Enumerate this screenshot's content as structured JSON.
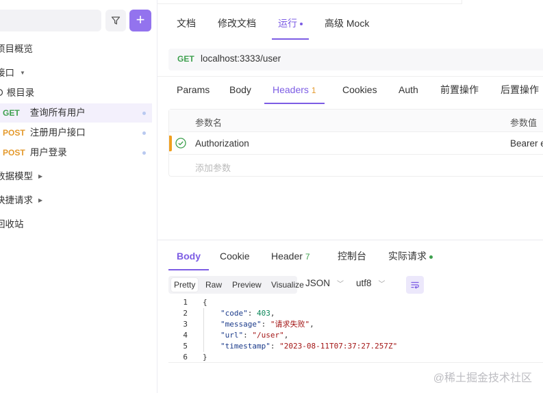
{
  "sidebar": {
    "nav": [
      {
        "label": "项目概览",
        "caret": ""
      },
      {
        "label": "接口",
        "caret": "▼"
      },
      {
        "label": "根目录",
        "caret": ""
      },
      {
        "label": "数据模型",
        "caret": "▶"
      },
      {
        "label": "快捷请求",
        "caret": "▶"
      },
      {
        "label": "回收站",
        "caret": ""
      }
    ],
    "apis": [
      {
        "method": "GET",
        "name": "查询所有用户"
      },
      {
        "method": "POST",
        "name": "注册用户接口"
      },
      {
        "method": "POST",
        "name": "用户登录"
      }
    ],
    "add_label": "+"
  },
  "tabs": [
    "文档",
    "修改文档",
    "运行",
    "高级 Mock"
  ],
  "active_tab": "运行",
  "request": {
    "method": "GET",
    "url": "localhost:3333/user"
  },
  "request_tabs": [
    {
      "label": "Params",
      "badge": ""
    },
    {
      "label": "Body",
      "badge": ""
    },
    {
      "label": "Headers",
      "badge": "1"
    },
    {
      "label": "Cookies",
      "badge": ""
    },
    {
      "label": "Auth",
      "badge": ""
    },
    {
      "label": "前置操作",
      "badge": ""
    },
    {
      "label": "后置操作",
      "badge": ""
    }
  ],
  "headers_table": {
    "col_name": "参数名",
    "col_value": "参数值",
    "rows": [
      {
        "key": "Authorization",
        "value": "Bearer e"
      }
    ],
    "add_placeholder": "添加参数"
  },
  "response_tabs": [
    {
      "label": "Body",
      "badge": ""
    },
    {
      "label": "Cookie",
      "badge": ""
    },
    {
      "label": "Header",
      "badge": "7"
    },
    {
      "label": "控制台",
      "badge": ""
    },
    {
      "label": "实际请求",
      "badge": ""
    }
  ],
  "format": {
    "options": [
      "Pretty",
      "Raw",
      "Preview",
      "Visualize"
    ],
    "active": "Pretty",
    "type": "JSON",
    "encoding": "utf8"
  },
  "code_lines": [
    {
      "n": "1",
      "text": "{"
    },
    {
      "n": "2",
      "key": "\"code\"",
      "sep": ": ",
      "val": "403",
      "vtype": "n",
      "end": ","
    },
    {
      "n": "3",
      "key": "\"message\"",
      "sep": ": ",
      "val": "\"请求失败\"",
      "vtype": "s",
      "end": ","
    },
    {
      "n": "4",
      "key": "\"url\"",
      "sep": ": ",
      "val": "\"/user\"",
      "vtype": "s",
      "end": ","
    },
    {
      "n": "5",
      "key": "\"timestamp\"",
      "sep": ": ",
      "val": "\"2023-08-11T07:37:27.257Z\"",
      "vtype": "s",
      "end": ""
    },
    {
      "n": "6",
      "text": "}"
    }
  ],
  "watermark": "@稀土掘金技术社区",
  "colors": {
    "accent": "#7c5ce4",
    "get": "#3ea04e",
    "post": "#e49a2d"
  }
}
